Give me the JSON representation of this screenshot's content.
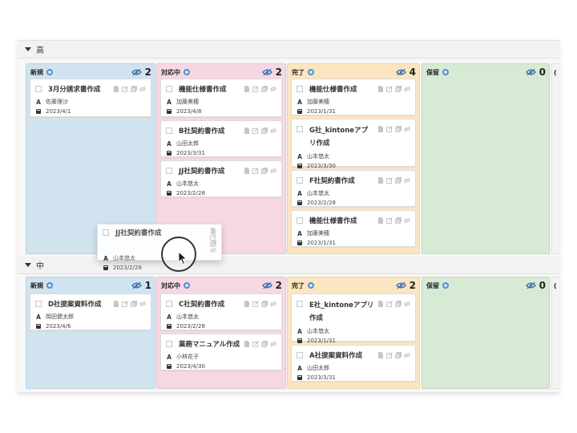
{
  "groups": [
    {
      "label": "高"
    },
    {
      "label": "中"
    }
  ],
  "lanes": [
    {
      "name": "新規",
      "bg": "#d2e3f0"
    },
    {
      "name": "対応中",
      "bg": "#f5d8e4"
    },
    {
      "name": "完了",
      "bg": "#fbe6c1"
    },
    {
      "name": "保留",
      "bg": "#d7ead3"
    },
    {
      "name": "(",
      "bg": "#f3f3f3"
    }
  ],
  "board": {
    "high": {
      "counts": [
        "2",
        "2",
        "4",
        "0"
      ],
      "cards": [
        [
          {
            "title": "3月分請求書作成",
            "user": "佐藤理沙",
            "date": "2023/4/1"
          }
        ],
        [
          {
            "title": "機能仕様書作成",
            "user": "加藤美穂",
            "date": "2023/4/8"
          },
          {
            "title": "B社契約書作成",
            "user": "山田太郎",
            "date": "2023/3/31"
          },
          {
            "title": "JJ社契約書作成",
            "user": "山本悠太",
            "date": "2023/2/28"
          }
        ],
        [
          {
            "title": "機能仕様書作成",
            "user": "加藤美穂",
            "date": "2023/1/31"
          },
          {
            "title": "G社_kintoneアプリ作成",
            "user": "山本悠太",
            "date": "2023/3/30"
          },
          {
            "title": "F社契約書作成",
            "user": "山本悠太",
            "date": "2023/2/28"
          },
          {
            "title": "機能仕様書作成",
            "user": "加藤美穂",
            "date": "2023/1/31"
          }
        ]
      ]
    },
    "mid": {
      "counts": [
        "1",
        "2",
        "2",
        "0"
      ],
      "cards": [
        [
          {
            "title": "D社提案資料作成",
            "user": "岡田健太郎",
            "date": "2023/4/6"
          }
        ],
        [
          {
            "title": "C社契約書作成",
            "user": "山本悠太",
            "date": "2023/2/28"
          },
          {
            "title": "業務マニュアル作成",
            "user": "小林花子",
            "date": "2023/4/30"
          }
        ],
        [
          {
            "title": "E社_kintoneアプリ作成",
            "user": "山本悠太",
            "date": "2023/1/31"
          },
          {
            "title": "A社提案資料作成",
            "user": "山田太郎",
            "date": "2023/3/31"
          }
        ]
      ]
    }
  },
  "drag_card": {
    "title": "JJ社契約書作成",
    "user": "山本悠太",
    "date": "2023/2/28"
  },
  "colors": {
    "info_dot": "#4b8fd6",
    "hidden_eye": "#3a6fb0"
  }
}
